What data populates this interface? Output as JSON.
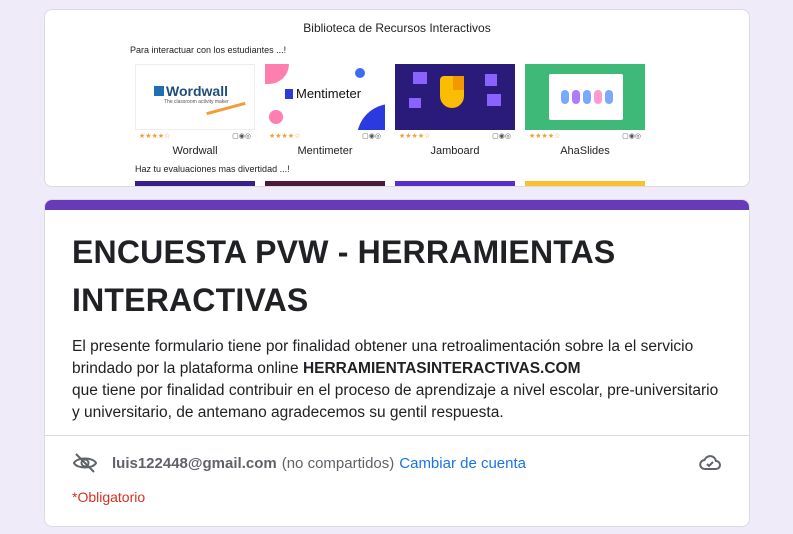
{
  "banner": {
    "title": "Biblioteca de Recursos Interactivos",
    "subtitle1": "Para interactuar con los estudiantes ...!",
    "subtitle2": "Haz tu evaluaciones mas divertidad ...!",
    "tiles": [
      {
        "name": "Wordwall",
        "logo_text": "Wordwall",
        "tagline": "The classroom activity maker",
        "rating": "★★★★☆",
        "tools": "▢◉◎"
      },
      {
        "name": "Mentimeter",
        "logo_text": "Mentimeter",
        "rating": "★★★★☆",
        "tools": "▢◉◎"
      },
      {
        "name": "Jamboard",
        "rating": "★★★★☆",
        "tools": "▢◉◎"
      },
      {
        "name": "AhaSlides",
        "rating": "★★★★☆",
        "tools": "▢◉◎"
      }
    ]
  },
  "form": {
    "accent_color": "#673ab7",
    "title": "ENCUESTA PVW - HERRAMIENTAS INTERACTIVAS",
    "description_part1": "El presente formulario tiene por finalidad obtener una retroalimentación sobre la el servicio brindado por la plataforma online ",
    "description_bold": "HERRAMIENTASINTERACTIVAS.COM",
    "description_part2": "que tiene por finalidad contribuir en el proceso de aprendizaje a nivel escolar, pre-universitario y universitario, de antemano agradecemos su gentil respuesta.",
    "account": {
      "email": "luis122448@gmail.com",
      "not_shared": "(no compartidos)",
      "switch_label": "Cambiar de cuenta"
    },
    "required_note": "*Obligatorio"
  }
}
